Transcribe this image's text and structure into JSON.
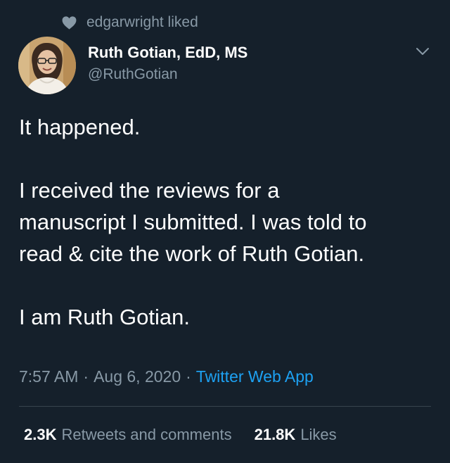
{
  "context": {
    "icon": "heart-icon",
    "text": "edgarwright liked"
  },
  "author": {
    "name": "Ruth Gotian, EdD, MS",
    "handle": "@RuthGotian"
  },
  "menu": {
    "icon": "chevron-down-icon"
  },
  "tweet": {
    "paragraphs": [
      {
        "lines": [
          "It happened."
        ]
      },
      {
        "lines": [
          "I received the reviews for a",
          "manuscript I submitted. I was told to",
          "read & cite the work of Ruth Gotian."
        ]
      },
      {
        "lines": [
          "I am Ruth Gotian."
        ]
      }
    ]
  },
  "meta": {
    "time": "7:57 AM",
    "separator": "·",
    "date": "Aug 6, 2020",
    "source": "Twitter Web App"
  },
  "stats": {
    "retweets_count": "2.3K",
    "retweets_label": "Retweets and comments",
    "likes_count": "21.8K",
    "likes_label": "Likes"
  },
  "colors": {
    "background": "#15202b",
    "secondary_text": "#8899a6",
    "link": "#1da1f2",
    "divider": "#38444d"
  }
}
